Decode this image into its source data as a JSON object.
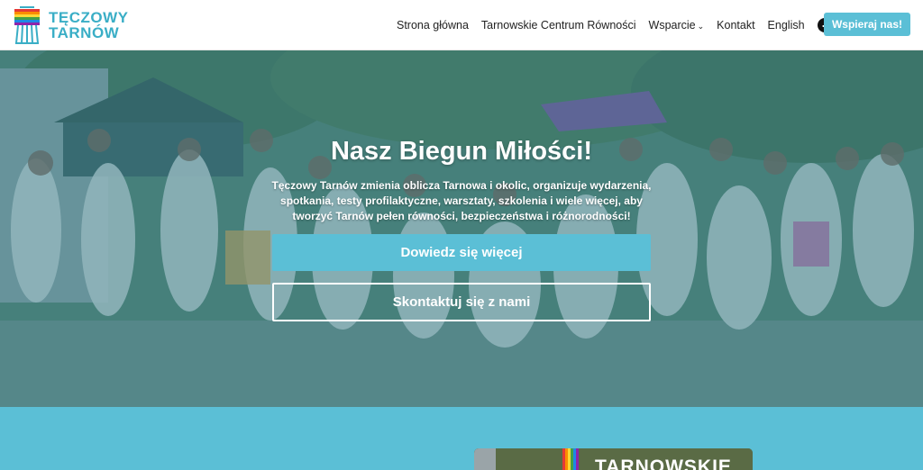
{
  "logo": {
    "line1": "TĘCZOWY",
    "line2": "TARNÓW"
  },
  "nav": {
    "items": [
      {
        "label": "Strona główna"
      },
      {
        "label": "Tarnowskie Centrum Równości"
      },
      {
        "label": "Wsparcie"
      },
      {
        "label": "Kontakt"
      },
      {
        "label": "English"
      }
    ],
    "social": [
      "facebook-icon",
      "instagram-icon",
      "tiktok-icon"
    ],
    "cta": "Wspieraj nas!"
  },
  "hero": {
    "title": "Nasz Biegun Miłości!",
    "description": "Tęczowy Tarnów zmienia oblicza Tarnowa i okolic, organizuje wydarzenia, spotkania, testy profilaktyczne, warsztaty, szkolenia i wiele więcej, aby tworzyć Tarnów pełen równości, bezpieczeństwa i różnorodności!",
    "primary_button": "Dowiedz się więcej",
    "secondary_button": "Skontaktuj się z nami"
  },
  "lower": {
    "card_text": "TARNOWSKIE"
  },
  "colors": {
    "accent": "#5bbfd6",
    "logo": "#3aaec6",
    "nav_text": "#222222"
  }
}
